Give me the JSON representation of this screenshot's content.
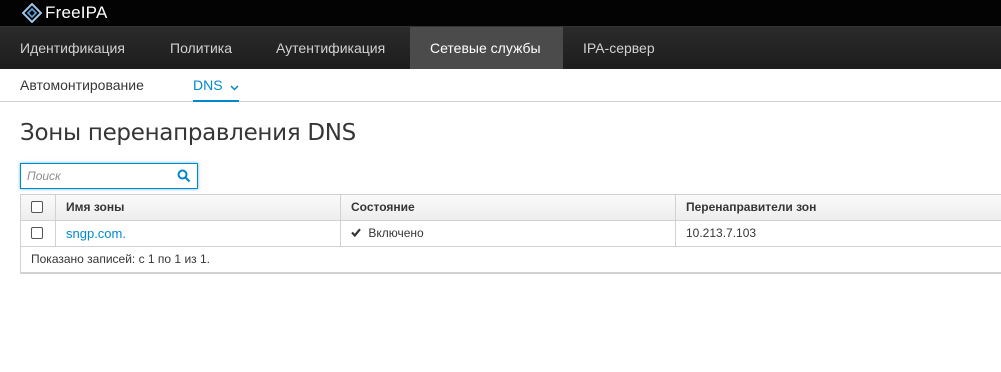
{
  "brand": {
    "name": "FreeIPA"
  },
  "nav": {
    "items": [
      {
        "label": "Идентификация"
      },
      {
        "label": "Политика"
      },
      {
        "label": "Аутентификация"
      },
      {
        "label": "Сетевые службы",
        "active": true
      },
      {
        "label": "IPA-сервер"
      }
    ]
  },
  "subnav": {
    "items": [
      {
        "label": "Автомонтирование"
      },
      {
        "label": "DNS",
        "active": true
      }
    ]
  },
  "page": {
    "title": "Зоны перенаправления DNS"
  },
  "search": {
    "placeholder": "Поиск",
    "value": ""
  },
  "table": {
    "columns": [
      "Имя зоны",
      "Состояние",
      "Перенаправители зон"
    ],
    "rows": [
      {
        "zone": "sngp.com.",
        "state": "Включено",
        "forwarders": "10.213.7.103"
      }
    ],
    "footer": "Показано записей: с 1 по 1 из 1."
  },
  "colors": {
    "accent": "#0088ce",
    "topbar": "#030303",
    "navbar": "#1d1d1d",
    "active_nav": "#4b4b4b"
  },
  "icons": {
    "search": "search-icon",
    "check": "check-icon",
    "chevron": "chevron-down-icon",
    "logo": "freeipa-logo-icon"
  }
}
